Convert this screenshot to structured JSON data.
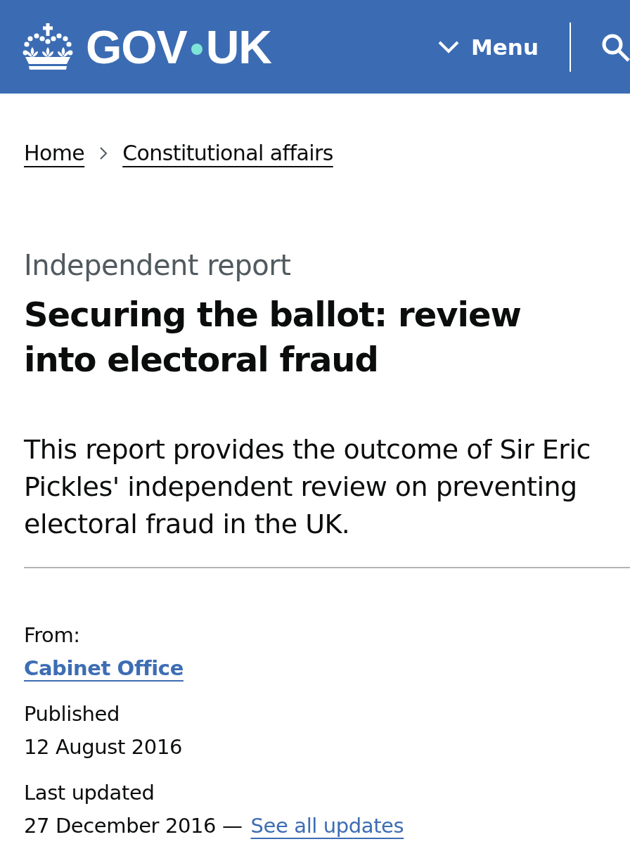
{
  "header": {
    "logo": {
      "left": "GOV",
      "right": "UK"
    },
    "menu_button": {
      "label": "Menu",
      "expanded": false
    }
  },
  "breadcrumbs": [
    {
      "label": "Home"
    },
    {
      "label": "Constitutional affairs"
    }
  ],
  "document": {
    "type": "Independent report",
    "title": "Securing the ballot: review into electoral fraud",
    "description": "This report provides the outcome of Sir Eric Pickles' independent review on preventing electoral fraud in the UK."
  },
  "metadata": {
    "from_label": "From:",
    "organisation": "Cabinet Office",
    "published_label": "Published",
    "published_date": "12 August 2016",
    "updated_label": "Last updated",
    "updated_date": "27 December 2016 —",
    "updates_link": "See all updates"
  }
}
